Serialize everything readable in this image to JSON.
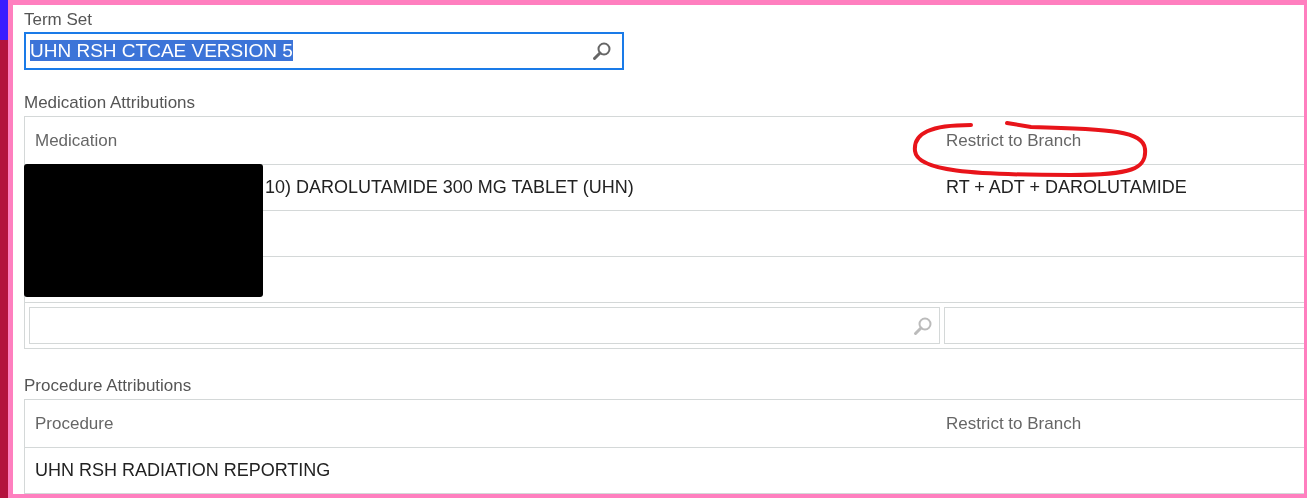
{
  "term_set": {
    "label": "Term Set",
    "value": "UHN RSH CTCAE VERSION 5",
    "value_selected": true
  },
  "medication_attributions": {
    "label": "Medication Attributions",
    "redacted": true,
    "columns": [
      {
        "label": "Medication",
        "annotated": false
      },
      {
        "label": "Restrict to Branch",
        "annotated": true
      }
    ],
    "rows": [
      {
        "medication": "10) DAROLUTAMIDE 300 MG TABLET (UHN)",
        "branch": "RT + ADT + DAROLUTAMIDE"
      },
      {
        "medication": "",
        "branch": ""
      },
      {
        "medication": "",
        "branch": ""
      }
    ],
    "filter_row": true
  },
  "procedure_attributions": {
    "label": "Procedure Attributions",
    "columns": [
      {
        "label": "Procedure",
        "annotated": false
      },
      {
        "label": "Restrict to Branch",
        "annotated": false
      }
    ],
    "rows": [
      {
        "procedure": "UHN RSH RADIATION REPORTING",
        "branch": ""
      }
    ]
  }
}
